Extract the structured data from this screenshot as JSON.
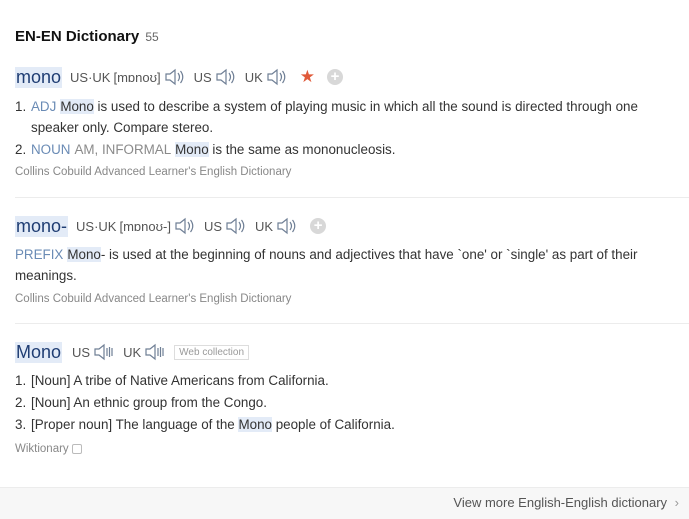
{
  "header": {
    "title": "EN-EN Dictionary",
    "count": "55"
  },
  "entries": [
    {
      "headword": "mono",
      "pron_combined_label": "US·UK",
      "pron_combined_ipa": "[mɒnoʊ]",
      "pron_us_label": "US",
      "pron_uk_label": "UK",
      "star": "★",
      "plus": "+",
      "senses": [
        {
          "num": "1.",
          "pos": "ADJ",
          "hl": "Mono",
          "text": " is used to describe a system of playing music in which all the sound is directed through one speaker only. Compare stereo."
        },
        {
          "num": "2.",
          "pos": "NOUN",
          "register": "AM, INFORMAL",
          "hl": "Mono",
          "text": " is the same as mononucleosis."
        }
      ],
      "source": "Collins Cobuild Advanced Learner's English Dictionary"
    },
    {
      "headword": "mono-",
      "pron_combined_label": "US·UK",
      "pron_combined_ipa": "[mɒnoʊ-]",
      "pron_us_label": "US",
      "pron_uk_label": "UK",
      "plus": "+",
      "senses": [
        {
          "pos": "PREFIX",
          "hl": "Mono",
          "text": "- is used at the beginning of nouns and adjectives that have `one' or `single' as part of their meanings."
        }
      ],
      "source": "Collins Cobuild Advanced Learner's English Dictionary"
    },
    {
      "headword": "Mono",
      "pron_us_label": "US",
      "pron_uk_label": "UK",
      "web_tag": "Web collection",
      "senses": [
        {
          "num": "1.",
          "text": "[Noun] A tribe of Native Americans from California."
        },
        {
          "num": "2.",
          "text": "[Noun] An ethnic group from the Congo."
        },
        {
          "num": "3.",
          "text_before": "[Proper noun] The language of the ",
          "hl": "Mono",
          "text": " people of California."
        }
      ],
      "source": "Wiktionary"
    }
  ],
  "footer": {
    "link_label": "View more English-English dictionary",
    "chevron": "›"
  }
}
